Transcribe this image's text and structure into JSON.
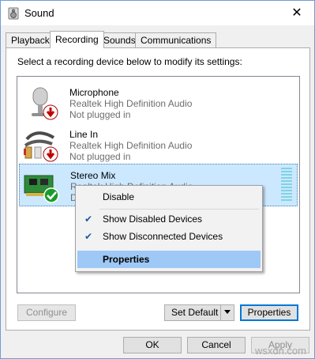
{
  "window": {
    "title": "Sound",
    "close_glyph": "✕"
  },
  "tabs": [
    {
      "label": "Playback",
      "active": false
    },
    {
      "label": "Recording",
      "active": true
    },
    {
      "label": "Sounds",
      "active": false
    },
    {
      "label": "Communications",
      "active": false
    }
  ],
  "instruction": "Select a recording device below to modify its settings:",
  "devices": [
    {
      "name": "Microphone",
      "driver": "Realtek High Definition Audio",
      "status": "Not plugged in",
      "icon": "microphone-icon",
      "badge": "red-down-arrow-badge",
      "selected": false
    },
    {
      "name": "Line In",
      "driver": "Realtek High Definition Audio",
      "status": "Not plugged in",
      "icon": "line-in-cable-icon",
      "badge": "red-down-arrow-badge",
      "selected": false
    },
    {
      "name": "Stereo Mix",
      "driver": "Realtek High Definition Audio",
      "status": "D",
      "icon": "sound-card-icon",
      "badge": "green-check-badge",
      "selected": true
    }
  ],
  "context_menu": {
    "items": [
      {
        "label": "Disable",
        "checked": false,
        "highlighted": false
      },
      {
        "label": "Show Disabled Devices",
        "checked": true,
        "highlighted": false
      },
      {
        "label": "Show Disconnected Devices",
        "checked": true,
        "highlighted": false
      },
      {
        "label": "Properties",
        "checked": false,
        "highlighted": true
      }
    ]
  },
  "buttons": {
    "configure": {
      "label": "Configure",
      "enabled": false
    },
    "set_default": {
      "label": "Set Default",
      "enabled": true
    },
    "properties": {
      "label": "Properties",
      "enabled": true
    },
    "ok": {
      "label": "OK",
      "enabled": true
    },
    "cancel": {
      "label": "Cancel",
      "enabled": true
    },
    "apply": {
      "label": "Apply",
      "enabled": false
    }
  },
  "watermark": "wsxdn.com",
  "colors": {
    "selection": "#cce8ff",
    "menu_highlight": "#9ec8f5",
    "level_meter": "#7fd3e3",
    "focus": "#0078d7"
  }
}
